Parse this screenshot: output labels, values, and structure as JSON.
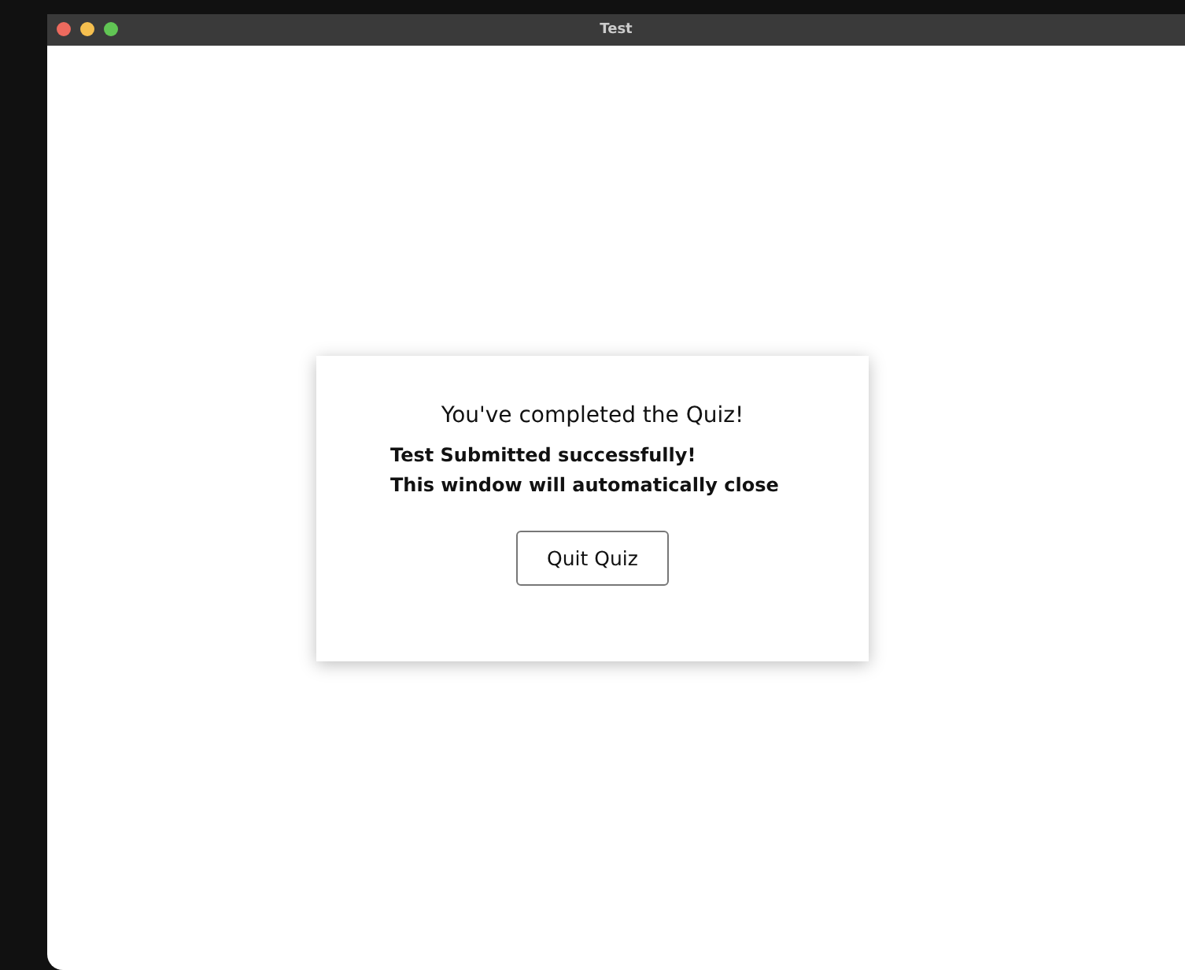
{
  "window": {
    "title": "Test"
  },
  "dialog": {
    "heading": "You've completed the Quiz!",
    "lines": [
      "Test Submitted successfully!",
      "This window will automatically close"
    ],
    "button": "Quit Quiz"
  }
}
